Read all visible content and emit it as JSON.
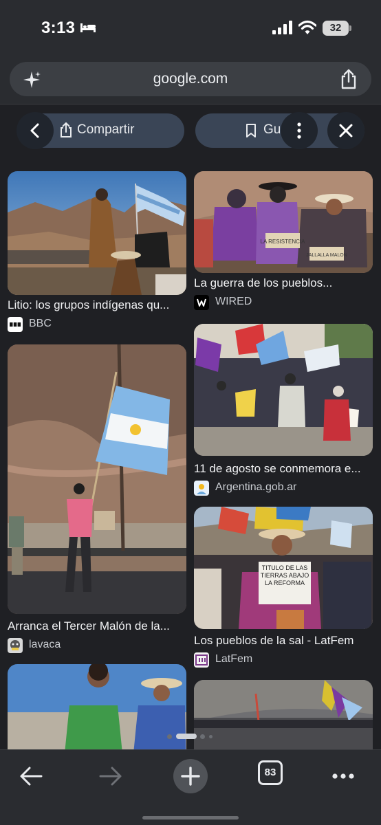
{
  "status_bar": {
    "time": "3:13",
    "battery": "32"
  },
  "url_bar": {
    "url": "google.com"
  },
  "actions": {
    "share_label": "Compartir",
    "save_label": "Guardar"
  },
  "results": [
    {
      "title": "Litio: los grupos indígenas qu...",
      "source": "BBC",
      "source_icon_text": "•••"
    },
    {
      "title": "La guerra de los pueblos...",
      "source": "WIRED",
      "source_icon_text": "W"
    },
    {
      "title": "11 de agosto se conmemora e...",
      "source": "Argentina.gob.ar",
      "source_icon_text": ""
    },
    {
      "title": "Arranca el Tercer Malón de la...",
      "source": "lavaca",
      "source_icon_text": ""
    },
    {
      "title": "Los pueblos de la sal - LatFem",
      "source": "LatFem",
      "source_icon_text": ""
    }
  ],
  "image_text": {
    "sign_1a": "LA RESISTENCIA",
    "sign_1b": "JALLALLA MALON",
    "sign_2": "TITULO DE LAS TIERRAS ABAJO LA REFORMA"
  },
  "toolbar": {
    "tab_count": "83"
  },
  "colors": {
    "background": "#1f2024",
    "chrome": "#2a2c30",
    "pill": "#3a4556",
    "text": "#e8eaed"
  }
}
